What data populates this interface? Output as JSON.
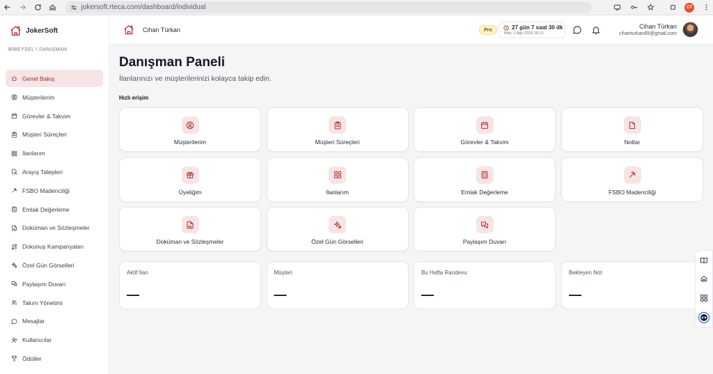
{
  "browser": {
    "url": "jokersoft.rteca.com/dashboard/individual",
    "profile_initials": "CT"
  },
  "brand": {
    "name": "JokerSoft",
    "breadcrumb": "BİREYSEL / DANIŞMAN",
    "accent": "#b8312f"
  },
  "sidebar": {
    "items": [
      {
        "label": "Genel Bakış",
        "icon": "home-icon",
        "active": true
      },
      {
        "label": "Müşterilerim",
        "icon": "user-circle-icon"
      },
      {
        "label": "Görevler & Takvim",
        "icon": "calendar-icon"
      },
      {
        "label": "Müşteri Süreçleri",
        "icon": "clipboard-icon"
      },
      {
        "label": "İlanlarım",
        "icon": "grid-icon"
      },
      {
        "label": "Arayış Talepleri",
        "icon": "file-search-icon"
      },
      {
        "label": "FSBO Madenciliği",
        "icon": "pickaxe-icon"
      },
      {
        "label": "Emlak Değerleme",
        "icon": "calculator-icon"
      },
      {
        "label": "Doküman ve Sözleşmeler",
        "icon": "file-signature-icon"
      },
      {
        "label": "Dokunuş Kampanyaları",
        "icon": "route-icon"
      },
      {
        "label": "Özel Gün Görselleri",
        "icon": "sparkles-icon"
      },
      {
        "label": "Paylaşım Duvarı",
        "icon": "messages-icon"
      },
      {
        "label": "Takım Yönetimi",
        "icon": "users-icon"
      },
      {
        "label": "Mesajlar",
        "icon": "chat-icon"
      },
      {
        "label": "Kullanıcılar",
        "icon": "user-plus-icon"
      },
      {
        "label": "Ödüller",
        "icon": "trophy-icon"
      }
    ]
  },
  "header": {
    "user_title": "Cihan Türkan",
    "plan_badge": "Pro",
    "timer_main": "27 gün 7 saat 30 dk",
    "timer_sub": "Bitiş: 1 Ağu 2026 18:13",
    "user_name": "Cihan Türkan",
    "user_email": "cihanturkan85@gmail.com"
  },
  "main": {
    "title": "Danışman Paneli",
    "subtitle": "İlanlarınızı ve müşterilerinizi kolayca takip edin.",
    "quick_label": "Hızlı erişim",
    "quick_cards": [
      {
        "label": "Müşterilerim",
        "icon": "user-circle-icon"
      },
      {
        "label": "Müşteri Süreçleri",
        "icon": "clipboard-icon"
      },
      {
        "label": "Görevler & Takvim",
        "icon": "calendar-icon"
      },
      {
        "label": "Notlar",
        "icon": "note-icon"
      },
      {
        "label": "Üyeliğim",
        "icon": "gift-icon"
      },
      {
        "label": "İlanlarım",
        "icon": "grid-icon"
      },
      {
        "label": "Emlak Değerleme",
        "icon": "calculator-icon"
      },
      {
        "label": "FSBO Madenciliği",
        "icon": "pickaxe-icon"
      },
      {
        "label": "Doküman ve Sözleşmeler",
        "icon": "file-signature-icon"
      },
      {
        "label": "Özel Gün Görselleri",
        "icon": "sparkles-icon"
      },
      {
        "label": "Paylaşım Duvarı",
        "icon": "messages-icon"
      }
    ],
    "stats": [
      {
        "label": "Aktif İlan",
        "value": "—"
      },
      {
        "label": "Müşteri",
        "value": "—"
      },
      {
        "label": "Bu Hafta Randevu",
        "value": "—"
      },
      {
        "label": "Bekleyen Not",
        "value": "—"
      }
    ]
  }
}
